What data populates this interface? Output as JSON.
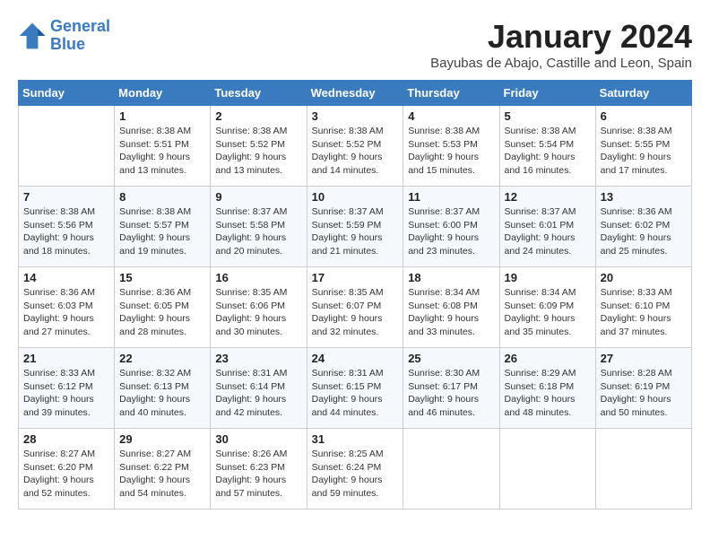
{
  "header": {
    "logo_line1": "General",
    "logo_line2": "Blue",
    "title": "January 2024",
    "subtitle": "Bayubas de Abajo, Castille and Leon, Spain"
  },
  "weekdays": [
    "Sunday",
    "Monday",
    "Tuesday",
    "Wednesday",
    "Thursday",
    "Friday",
    "Saturday"
  ],
  "weeks": [
    [
      {
        "day": "",
        "info": ""
      },
      {
        "day": "1",
        "info": "Sunrise: 8:38 AM\nSunset: 5:51 PM\nDaylight: 9 hours\nand 13 minutes."
      },
      {
        "day": "2",
        "info": "Sunrise: 8:38 AM\nSunset: 5:52 PM\nDaylight: 9 hours\nand 13 minutes."
      },
      {
        "day": "3",
        "info": "Sunrise: 8:38 AM\nSunset: 5:52 PM\nDaylight: 9 hours\nand 14 minutes."
      },
      {
        "day": "4",
        "info": "Sunrise: 8:38 AM\nSunset: 5:53 PM\nDaylight: 9 hours\nand 15 minutes."
      },
      {
        "day": "5",
        "info": "Sunrise: 8:38 AM\nSunset: 5:54 PM\nDaylight: 9 hours\nand 16 minutes."
      },
      {
        "day": "6",
        "info": "Sunrise: 8:38 AM\nSunset: 5:55 PM\nDaylight: 9 hours\nand 17 minutes."
      }
    ],
    [
      {
        "day": "7",
        "info": "Sunrise: 8:38 AM\nSunset: 5:56 PM\nDaylight: 9 hours\nand 18 minutes."
      },
      {
        "day": "8",
        "info": "Sunrise: 8:38 AM\nSunset: 5:57 PM\nDaylight: 9 hours\nand 19 minutes."
      },
      {
        "day": "9",
        "info": "Sunrise: 8:37 AM\nSunset: 5:58 PM\nDaylight: 9 hours\nand 20 minutes."
      },
      {
        "day": "10",
        "info": "Sunrise: 8:37 AM\nSunset: 5:59 PM\nDaylight: 9 hours\nand 21 minutes."
      },
      {
        "day": "11",
        "info": "Sunrise: 8:37 AM\nSunset: 6:00 PM\nDaylight: 9 hours\nand 23 minutes."
      },
      {
        "day": "12",
        "info": "Sunrise: 8:37 AM\nSunset: 6:01 PM\nDaylight: 9 hours\nand 24 minutes."
      },
      {
        "day": "13",
        "info": "Sunrise: 8:36 AM\nSunset: 6:02 PM\nDaylight: 9 hours\nand 25 minutes."
      }
    ],
    [
      {
        "day": "14",
        "info": "Sunrise: 8:36 AM\nSunset: 6:03 PM\nDaylight: 9 hours\nand 27 minutes."
      },
      {
        "day": "15",
        "info": "Sunrise: 8:36 AM\nSunset: 6:05 PM\nDaylight: 9 hours\nand 28 minutes."
      },
      {
        "day": "16",
        "info": "Sunrise: 8:35 AM\nSunset: 6:06 PM\nDaylight: 9 hours\nand 30 minutes."
      },
      {
        "day": "17",
        "info": "Sunrise: 8:35 AM\nSunset: 6:07 PM\nDaylight: 9 hours\nand 32 minutes."
      },
      {
        "day": "18",
        "info": "Sunrise: 8:34 AM\nSunset: 6:08 PM\nDaylight: 9 hours\nand 33 minutes."
      },
      {
        "day": "19",
        "info": "Sunrise: 8:34 AM\nSunset: 6:09 PM\nDaylight: 9 hours\nand 35 minutes."
      },
      {
        "day": "20",
        "info": "Sunrise: 8:33 AM\nSunset: 6:10 PM\nDaylight: 9 hours\nand 37 minutes."
      }
    ],
    [
      {
        "day": "21",
        "info": "Sunrise: 8:33 AM\nSunset: 6:12 PM\nDaylight: 9 hours\nand 39 minutes."
      },
      {
        "day": "22",
        "info": "Sunrise: 8:32 AM\nSunset: 6:13 PM\nDaylight: 9 hours\nand 40 minutes."
      },
      {
        "day": "23",
        "info": "Sunrise: 8:31 AM\nSunset: 6:14 PM\nDaylight: 9 hours\nand 42 minutes."
      },
      {
        "day": "24",
        "info": "Sunrise: 8:31 AM\nSunset: 6:15 PM\nDaylight: 9 hours\nand 44 minutes."
      },
      {
        "day": "25",
        "info": "Sunrise: 8:30 AM\nSunset: 6:17 PM\nDaylight: 9 hours\nand 46 minutes."
      },
      {
        "day": "26",
        "info": "Sunrise: 8:29 AM\nSunset: 6:18 PM\nDaylight: 9 hours\nand 48 minutes."
      },
      {
        "day": "27",
        "info": "Sunrise: 8:28 AM\nSunset: 6:19 PM\nDaylight: 9 hours\nand 50 minutes."
      }
    ],
    [
      {
        "day": "28",
        "info": "Sunrise: 8:27 AM\nSunset: 6:20 PM\nDaylight: 9 hours\nand 52 minutes."
      },
      {
        "day": "29",
        "info": "Sunrise: 8:27 AM\nSunset: 6:22 PM\nDaylight: 9 hours\nand 54 minutes."
      },
      {
        "day": "30",
        "info": "Sunrise: 8:26 AM\nSunset: 6:23 PM\nDaylight: 9 hours\nand 57 minutes."
      },
      {
        "day": "31",
        "info": "Sunrise: 8:25 AM\nSunset: 6:24 PM\nDaylight: 9 hours\nand 59 minutes."
      },
      {
        "day": "",
        "info": ""
      },
      {
        "day": "",
        "info": ""
      },
      {
        "day": "",
        "info": ""
      }
    ]
  ]
}
